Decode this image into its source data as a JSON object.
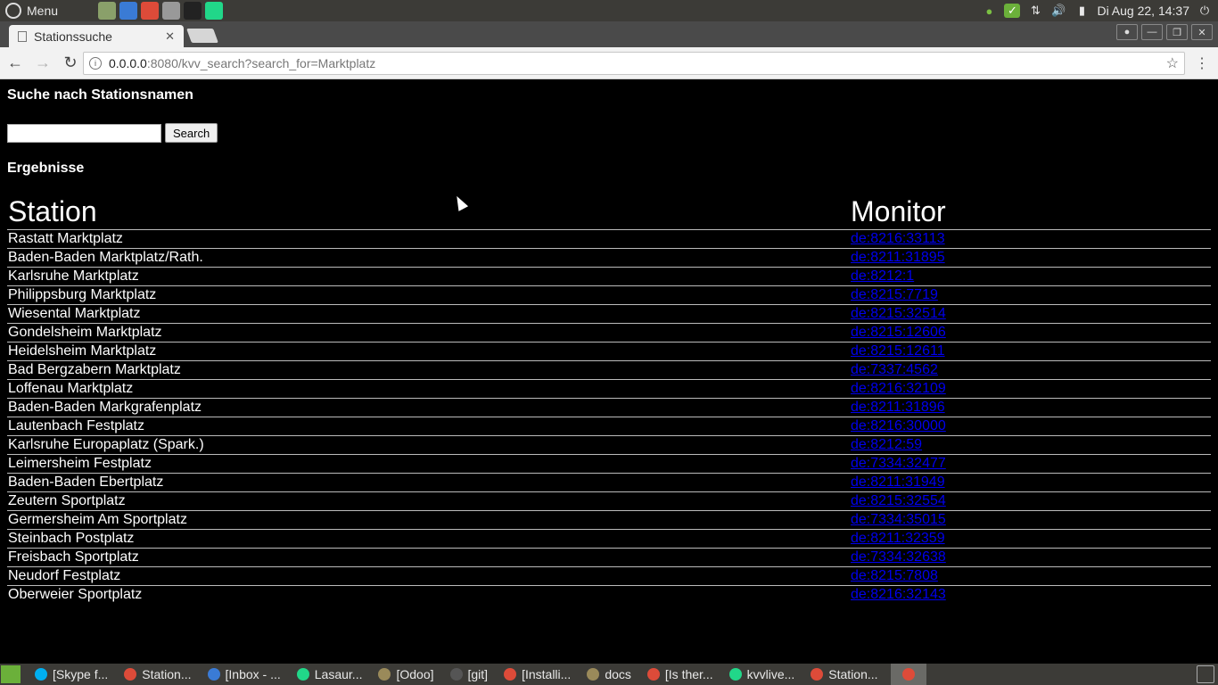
{
  "os_panel": {
    "menu_label": "Menu",
    "launchers": [
      {
        "name": "file-manager-icon",
        "color": "#8aa06a"
      },
      {
        "name": "thunderbird-icon",
        "color": "#3a7bd5"
      },
      {
        "name": "chrome-icon",
        "color": "#dd4b39"
      },
      {
        "name": "calculator-icon",
        "color": "#999999"
      },
      {
        "name": "inkscape-icon",
        "color": "#222222"
      },
      {
        "name": "pycharm-icon",
        "color": "#21d789"
      }
    ],
    "clock": "Di Aug 22, 14:37"
  },
  "browser": {
    "tab_title": "Stationssuche",
    "url_host": "0.0.0.0",
    "url_rest": ":8080/kvv_search?search_for=Marktplatz"
  },
  "page": {
    "title": "Suche nach Stationsnamen",
    "search_input_value": "",
    "search_button_label": "Search",
    "results_title": "Ergebnisse",
    "table": {
      "headers": [
        "Station",
        "Monitor"
      ],
      "rows": [
        {
          "station": "Rastatt Marktplatz",
          "monitor": "de:8216:33113"
        },
        {
          "station": "Baden-Baden Marktplatz/Rath.",
          "monitor": "de:8211:31895"
        },
        {
          "station": "Karlsruhe Marktplatz",
          "monitor": "de:8212:1"
        },
        {
          "station": "Philippsburg Marktplatz",
          "monitor": "de:8215:7719"
        },
        {
          "station": "Wiesental Marktplatz",
          "monitor": "de:8215:32514"
        },
        {
          "station": "Gondelsheim Marktplatz",
          "monitor": "de:8215:12606"
        },
        {
          "station": "Heidelsheim Marktplatz",
          "monitor": "de:8215:12611"
        },
        {
          "station": "Bad Bergzabern Marktplatz",
          "monitor": "de:7337:4562"
        },
        {
          "station": "Loffenau Marktplatz",
          "monitor": "de:8216:32109"
        },
        {
          "station": "Baden-Baden Markgrafenplatz",
          "monitor": "de:8211:31896"
        },
        {
          "station": "Lautenbach Festplatz",
          "monitor": "de:8216:30000"
        },
        {
          "station": "Karlsruhe Europaplatz (Spark.)",
          "monitor": "de:8212:59"
        },
        {
          "station": "Leimersheim Festplatz",
          "monitor": "de:7334:32477"
        },
        {
          "station": "Baden-Baden Ebertplatz",
          "monitor": "de:8211:31949"
        },
        {
          "station": "Zeutern Sportplatz",
          "monitor": "de:8215:32554"
        },
        {
          "station": "Germersheim Am Sportplatz",
          "monitor": "de:7334:35015"
        },
        {
          "station": "Steinbach Postplatz",
          "monitor": "de:8211:32359"
        },
        {
          "station": "Freisbach Sportplatz",
          "monitor": "de:7334:32638"
        },
        {
          "station": "Neudorf Festplatz",
          "monitor": "de:8215:7808"
        },
        {
          "station": "Oberweier Sportplatz",
          "monitor": "de:8216:32143"
        }
      ]
    }
  },
  "taskbar": {
    "tasks": [
      {
        "label": "[Skype f...",
        "icon": "skype-icon",
        "color": "#00aff0"
      },
      {
        "label": "Station...",
        "icon": "chrome-icon",
        "color": "#dd4b39"
      },
      {
        "label": "[Inbox - ...",
        "icon": "thunderbird-icon",
        "color": "#3a7bd5"
      },
      {
        "label": "Lasaur...",
        "icon": "pycharm-icon",
        "color": "#21d789"
      },
      {
        "label": "[Odoo]",
        "icon": "folder-icon",
        "color": "#9a8a5a"
      },
      {
        "label": "[git]",
        "icon": "terminal-icon",
        "color": "#555555"
      },
      {
        "label": "[Installi...",
        "icon": "chrome-icon",
        "color": "#dd4b39"
      },
      {
        "label": "docs",
        "icon": "folder-icon",
        "color": "#9a8a5a"
      },
      {
        "label": "[Is ther...",
        "icon": "chrome-icon",
        "color": "#dd4b39"
      },
      {
        "label": "kvvlive...",
        "icon": "pycharm-icon",
        "color": "#21d789"
      },
      {
        "label": "Station...",
        "icon": "chrome-icon",
        "color": "#dd4b39"
      },
      {
        "label": "",
        "icon": "chrome-icon",
        "color": "#dd4b39",
        "active": true
      }
    ]
  }
}
